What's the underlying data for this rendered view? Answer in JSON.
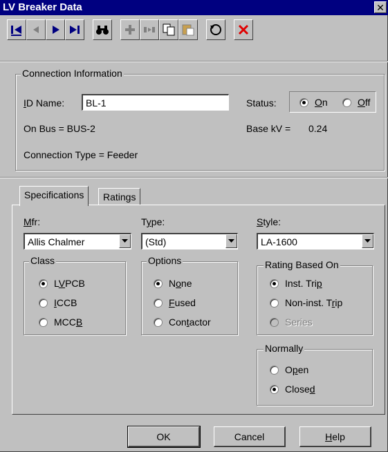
{
  "window": {
    "title": "LV Breaker Data",
    "close_label": "✕"
  },
  "toolbar": {
    "buttons": [
      "first-record",
      "previous-record",
      "next-record",
      "last-record",
      "find",
      "add",
      "insert",
      "copy",
      "paste",
      "undo",
      "delete"
    ]
  },
  "connection": {
    "group_title": "Connection Information",
    "id_label": "ID Name:",
    "id_value": "BL-1",
    "status_label": "Status:",
    "status_on": "On",
    "status_off": "Off",
    "status_selected": "On",
    "on_bus": "On Bus = BUS-2",
    "base_kv_label": "Base kV =",
    "base_kv_value": "0.24",
    "connection_type": "Connection Type = Feeder"
  },
  "tabs": {
    "specifications": "Specifications",
    "ratings": "Ratings",
    "active": "Specifications"
  },
  "specs": {
    "mfr_label": "Mfr:",
    "mfr_value": "Allis Chalmer",
    "type_label": "Type:",
    "type_value": "(Std)",
    "style_label": "Style:",
    "style_value": "LA-1600",
    "class_title": "Class",
    "class_options": [
      "LVPCB",
      "ICCB",
      "MCCB"
    ],
    "class_selected": "LVPCB",
    "options_title": "Options",
    "options_list": [
      "None",
      "Fused",
      "Contactor"
    ],
    "options_selected": "None",
    "rating_title": "Rating Based On",
    "rating_options": [
      "Inst. Trip",
      "Non-inst. Trip",
      "Series"
    ],
    "rating_selected": "Inst. Trip",
    "normally_title": "Normally",
    "normally_options": [
      "Open",
      "Closed"
    ],
    "normally_selected": "Closed"
  },
  "buttons": {
    "ok": "OK",
    "cancel": "Cancel",
    "help": "Help"
  }
}
